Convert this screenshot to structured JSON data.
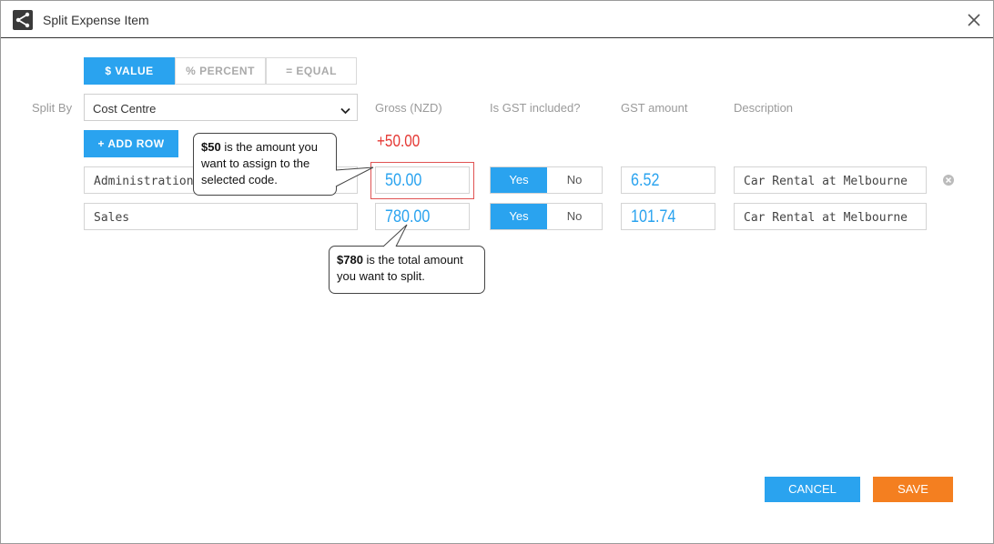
{
  "window": {
    "title": "Split Expense Item"
  },
  "tabs": [
    {
      "label": "$ VALUE",
      "active": true
    },
    {
      "label": "% PERCENT",
      "active": false
    },
    {
      "label": "= EQUAL",
      "active": false
    }
  ],
  "split_by": {
    "label": "Split By",
    "selected": "Cost Centre"
  },
  "columns": {
    "gross": "Gross (NZD)",
    "gst_included": "Is GST included?",
    "gst_amount": "GST amount",
    "description": "Description"
  },
  "add_row_label": "+ ADD ROW",
  "difference": "+50.00",
  "rows": [
    {
      "code": "Administration",
      "gross": "50.00",
      "gst_yes": "Yes",
      "gst_no": "No",
      "gst_amount": "6.52",
      "description": "Car Rental at Melbourne"
    },
    {
      "code": "Sales",
      "gross": "780.00",
      "gst_yes": "Yes",
      "gst_no": "No",
      "gst_amount": "101.74",
      "description": "Car Rental at Melbourne"
    }
  ],
  "callouts": {
    "first_bold": "$50",
    "first_text": " is the amount you want to assign to the selected code.",
    "second_bold": "$780",
    "second_text": " is the total amount you want to split."
  },
  "footer": {
    "cancel_label": "CANCEL",
    "save_label": "SAVE"
  },
  "colors": {
    "accent": "#2aa3ef",
    "save": "#f47f20",
    "difference": "#e53935",
    "highlight": "#e05252"
  }
}
